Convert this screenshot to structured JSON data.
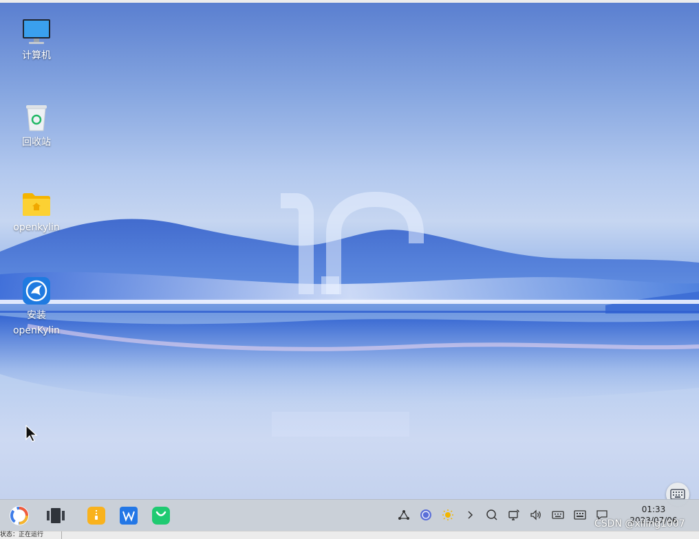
{
  "desktop": {
    "icons": [
      {
        "label": "计算机",
        "icon": "computer-icon"
      },
      {
        "label": "回收站",
        "icon": "trash-icon"
      },
      {
        "label": "openkylin",
        "icon": "home-folder-icon"
      },
      {
        "label_line1": "安装",
        "label_line2": "openKylin",
        "icon": "installer-icon"
      }
    ]
  },
  "taskbar": {
    "apps": [
      "start-menu-icon",
      "multitask-view-icon",
      "file-manager-icon",
      "wps-icon",
      "software-store-icon"
    ],
    "tray": [
      "network-icon",
      "vpn-icon",
      "brightness-icon",
      "expand-arrow-icon",
      "search-icon",
      "screen-projection-icon",
      "volume-icon",
      "keyboard-icon",
      "input-method-icon",
      "notification-icon"
    ],
    "clock": {
      "time": "01:33",
      "date": "2023/07/06"
    }
  },
  "watermark": "CSDN @xiling1007",
  "statusbar": {
    "text": "状态：正在运行"
  },
  "colors": {
    "accent": "#3d7ce8",
    "taskbar": "#c8ced6"
  }
}
